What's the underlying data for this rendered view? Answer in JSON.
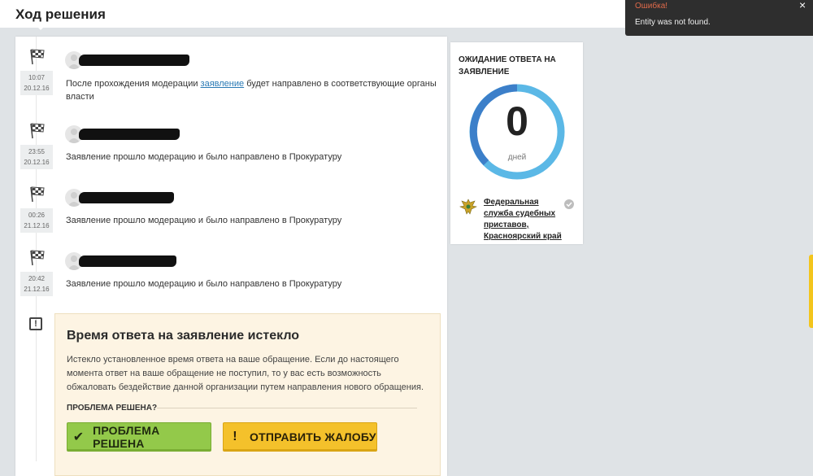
{
  "header": {
    "title": "Ход решения"
  },
  "timeline": {
    "events": [
      {
        "time": "10:07",
        "date": "20.12.16",
        "text_before_link": "После прохождения модерации ",
        "link_text": "заявление",
        "text_after_link": " будет направлено в соответствующие органы власти"
      },
      {
        "time": "23:55",
        "date": "20.12.16",
        "text": "Заявление прошло модерацию и было направлено в Прокуратуру"
      },
      {
        "time": "00:26",
        "date": "21.12.16",
        "text": "Заявление прошло модерацию и было направлено в Прокуратуру"
      },
      {
        "time": "20:42",
        "date": "21.12.16",
        "text": "Заявление прошло модерацию и было направлено в Прокуратуру"
      }
    ],
    "alert_icon_glyph": "!"
  },
  "expired": {
    "title": "Время ответа на заявление истекло",
    "text": "Истекло установленное время ответа на ваше обращение. Если до настоящего момента ответ на ваше обращение не поступил, то у вас есть возможность обжаловать бездействие данной организации путем направления нового обращения.",
    "question": "ПРОБЛЕМА РЕШЕНА?",
    "solved_button": {
      "icon_glyph": "✔",
      "label": "ПРОБЛЕМА РЕШЕНА"
    },
    "complain_button": {
      "icon_glyph": "!",
      "label": "ОТПРАВИТЬ ЖАЛОБУ"
    }
  },
  "waiting": {
    "title": "ОЖИДАНИЕ ОТВЕТА НА ЗАЯВЛЕНИЕ",
    "days_value": "0",
    "days_unit": "дней",
    "organization": "Федеральная служба судебных приставов, Красноярский край"
  },
  "toast": {
    "title": "Ошибка!",
    "message": "Entity was not found.",
    "close_glyph": "×"
  },
  "colors": {
    "ring_dark": "#3c7fc9",
    "ring_light": "#5bb8e6",
    "button_green": "#93c94a",
    "button_yellow": "#f4c12b",
    "link": "#2a7ab5",
    "toast_error": "#e06a4a"
  },
  "icons": {
    "event": "checkered-flag-icon",
    "avatar": "user-avatar-icon",
    "alert": "exclamation-square-icon",
    "organization": "eagle-emblem-icon",
    "verified": "check-circle-icon"
  }
}
